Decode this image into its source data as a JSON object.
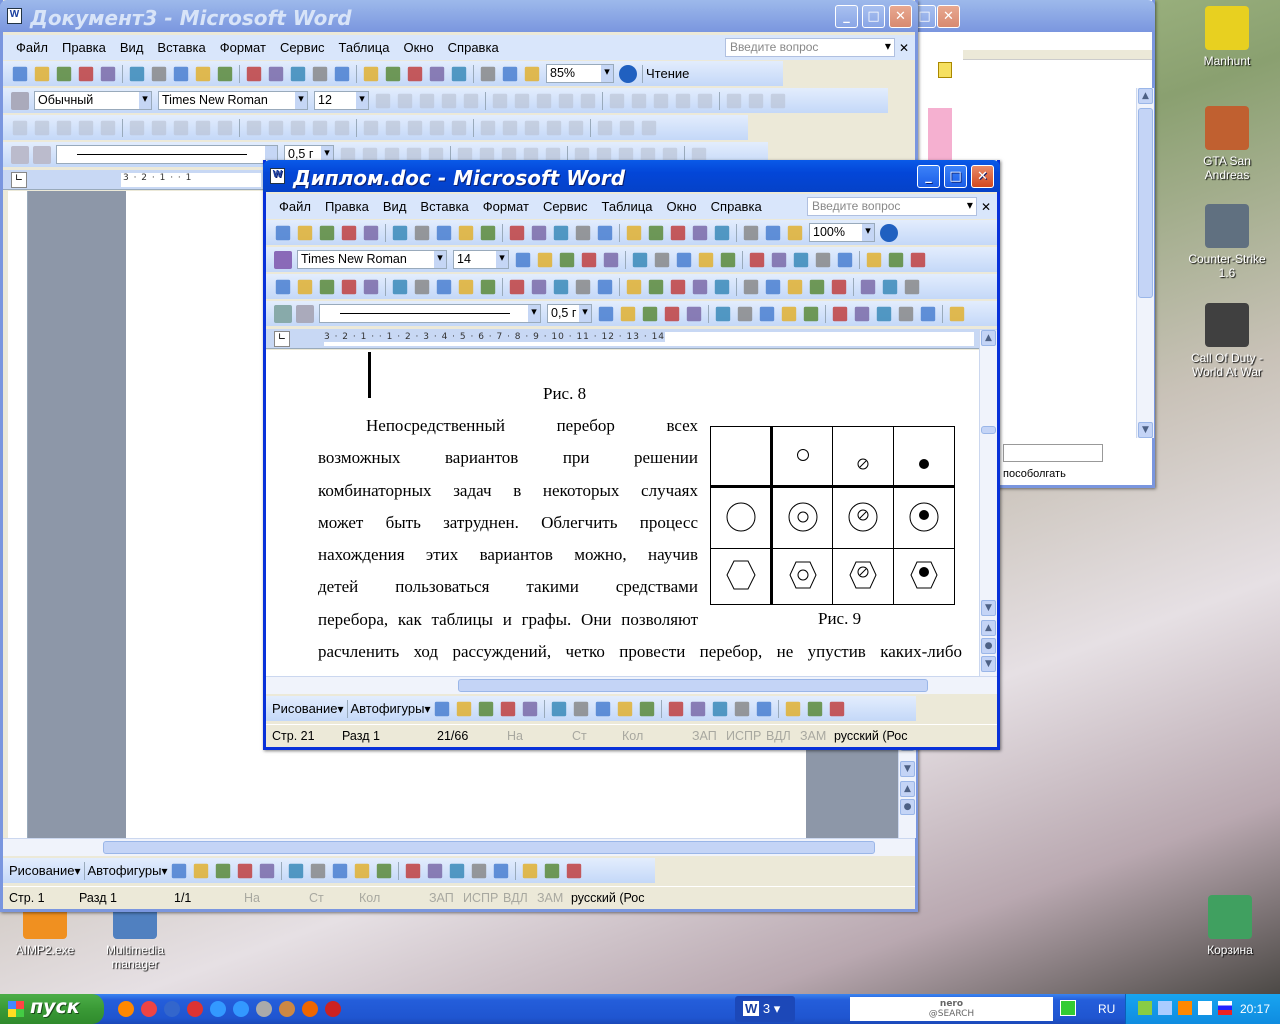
{
  "desktop": {
    "icons": [
      {
        "label": "Manhunt",
        "color": "#e8d020"
      },
      {
        "label": "GTA San Andreas",
        "color": "#c06030"
      },
      {
        "label": "Counter-Strike 1.6",
        "color": "#607080"
      },
      {
        "label": "Call Of Duty - World At War",
        "color": "#404040"
      },
      {
        "label": "AIMP2.exe",
        "color": "#f09020"
      },
      {
        "label": "Multimedia manager",
        "color": "#5080c0"
      },
      {
        "label": "Корзина",
        "color": "#40a060"
      }
    ]
  },
  "menu": [
    "Файл",
    "Правка",
    "Вид",
    "Вставка",
    "Формат",
    "Сервис",
    "Таблица",
    "Окно",
    "Справка"
  ],
  "ask_placeholder": "Введите вопрос",
  "back_window": {
    "title": "Документ3 - Microsoft Word",
    "zoom": "85%",
    "reading_button": "Чтение",
    "style": "Обычный",
    "font": "Times New Roman",
    "size": "12",
    "line_width": "0,5 г",
    "ruler": "3 · 2 · 1 ·   · 1",
    "drawing_label": "Рисование",
    "autoshapes_label": "Автофигуры",
    "status": {
      "page": "Стр. 1",
      "section": "Разд 1",
      "pages": "1/1",
      "at": "На",
      "line": "Ст",
      "col": "Кол",
      "rec": "ЗАП",
      "trk": "ИСПР",
      "ext": "ВДЛ",
      "ovr": "ЗАМ",
      "lang": "русский (Рос"
    }
  },
  "middle_window": {
    "field_text": "пособолгать"
  },
  "front_window": {
    "title": "Диплом.doc - Microsoft Word",
    "zoom": "100%",
    "font": "Times New Roman",
    "size": "14",
    "line_width": "0,5 г",
    "ruler": "3 · 2 · 1 ·   · 1 · 2 · 3 · 4 · 5 · 6 · 7 · 8 · 9 · 10 · 11 · 12 · 13 · 14",
    "drawing_label": "Рисование",
    "autoshapes_label": "Автофигуры",
    "document": {
      "caption_top": "Рис. 8",
      "paragraph_lines": [
        "Непосредственный перебор всех",
        "возможных вариантов при решении",
        "комбинаторных задач в некоторых случаях",
        "может быть затруднен. Облегчить процесс",
        "нахождения этих вариантов можно, научив",
        "детей пользоваться такими средствами",
        "перебора, как таблицы и графы. Они позволяют"
      ],
      "full_line": "расчленить ход рассуждений, четко провести перебор, не упустив каких-либо",
      "caption_figure": "Рис. 9"
    },
    "status": {
      "page": "Стр. 21",
      "section": "Разд 1",
      "pages": "21/66",
      "at": "На",
      "line": "Ст",
      "col": "Кол",
      "rec": "ЗАП",
      "trk": "ИСПР",
      "ext": "ВДЛ",
      "ovr": "ЗАМ",
      "lang": "русский (Рос"
    }
  },
  "toolbar_icons": {
    "standard": [
      "new",
      "open",
      "save",
      "permission",
      "email",
      "print",
      "print-preview",
      "spelling",
      "research",
      "cut",
      "copy",
      "paste",
      "format-painter",
      "undo",
      "redo",
      "hyperlink",
      "tables-borders",
      "insert-table",
      "insert-excel",
      "columns",
      "drawing",
      "document-map",
      "show-hide"
    ],
    "formatting": [
      "bold",
      "italic",
      "underline",
      "align-left",
      "center",
      "align-right",
      "justify",
      "line-spacing",
      "numbering",
      "bullets",
      "decrease-indent",
      "increase-indent",
      "border",
      "highlight",
      "font-color",
      "grow-font",
      "shrink-font",
      "superscript"
    ],
    "forms": [
      "design-mode",
      "properties",
      "checkbox",
      "textbox",
      "button",
      "option",
      "list",
      "combo",
      "toggle",
      "spin",
      "scroll",
      "label",
      "image",
      "more-controls",
      "insert-picture",
      "color",
      "more-contrast",
      "less-contrast",
      "more-bright",
      "less-bright",
      "crop",
      "rotate",
      "line-style",
      "compress",
      "text-wrap",
      "format-picture",
      "transparent",
      "reset"
    ],
    "tables": [
      "draw-table",
      "eraser",
      "line-style",
      "line-weight",
      "border-color",
      "borders",
      "shading",
      "insert-table",
      "merge",
      "split",
      "align",
      "distribute-rows",
      "distribute-cols",
      "autoformat",
      "text-direction",
      "sort"
    ],
    "drawing": [
      "select",
      "line",
      "arrow",
      "rectangle",
      "oval",
      "textbox",
      "wordart",
      "diagram",
      "clipart",
      "picture",
      "fill-color",
      "line-color",
      "font-color",
      "line-style",
      "dash-style",
      "arrow-style",
      "shadow",
      "3d"
    ]
  },
  "taskbar": {
    "start_label": "пуск",
    "word_group": "3",
    "search_brand": "nero",
    "search_sub": "@SEARCH",
    "lang": "RU",
    "clock": "20:17"
  }
}
